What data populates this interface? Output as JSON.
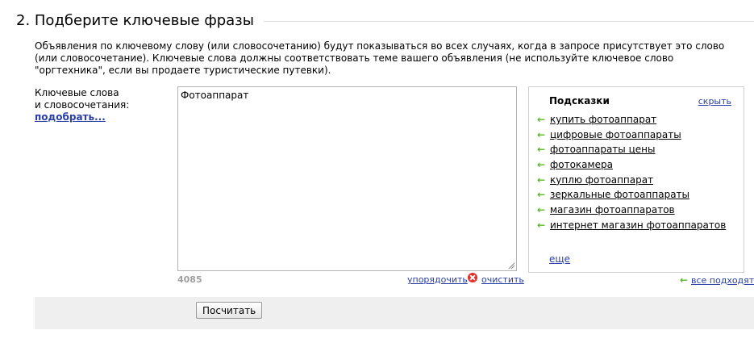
{
  "section": {
    "title": "2. Подберите ключевые фразы"
  },
  "intro_text": "Объявления по ключевому слову (или словосочетанию) будут показываться во всех случаях, когда в запросе присутствует это слово (или словосочетание). Ключевые слова должны соответствовать теме вашего объявления (не используйте ключевое слово \"оргтехника\", если вы продаете туристические путевки).",
  "keywords": {
    "label_line1": "Ключевые слова",
    "label_line2": "и словосочетания:",
    "pick_link": "подобрать...",
    "value": "Фотоаппарат",
    "char_count": "4085",
    "sort_link": "упорядочить",
    "clear_link": "очистить"
  },
  "hints": {
    "title": "Подсказки",
    "hide_link": "скрыть",
    "items": [
      "купить фотоаппарат",
      "цифровые фотоаппараты",
      "фотоаппараты цены",
      "фотокамера",
      "куплю фотоаппарат",
      "зеркальные фотоаппараты",
      "магазин фотоаппаратов",
      "интернет магазин фотоаппаратов"
    ],
    "more_link": "еще",
    "all_fit_link": "все подходят"
  },
  "actions": {
    "calculate_label": "Посчитать"
  },
  "icons": {
    "hint_arrow": "arrow-left-icon",
    "clear": "clear-icon",
    "resize": "resize-grip-icon"
  },
  "colors": {
    "link": "#2a3fa5",
    "arrow": "#5ab52a",
    "clear_icon": "#e2302b",
    "bar_bg": "#efefef"
  }
}
